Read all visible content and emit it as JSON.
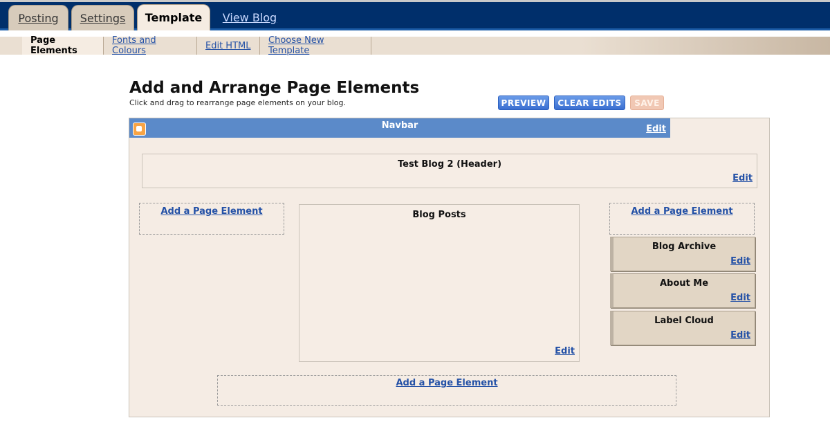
{
  "tabs": {
    "posting": "Posting",
    "settings": "Settings",
    "template": "Template",
    "view_blog": "View Blog"
  },
  "subnav": {
    "page_elements": "Page Elements",
    "fonts_colours": "Fonts and Colours",
    "edit_html": "Edit HTML",
    "choose_template": "Choose New Template"
  },
  "heading": {
    "title": "Add and Arrange Page Elements",
    "subtitle": "Click and drag to rearrange page elements on your blog."
  },
  "buttons": {
    "preview": "PREVIEW",
    "clear_edits": "CLEAR EDITS",
    "save": "SAVE"
  },
  "navbar": {
    "label": "Navbar",
    "edit": "Edit"
  },
  "header": {
    "title": "Test Blog 2 (Header)",
    "edit": "Edit"
  },
  "left_column": {
    "add": "Add a Page Element"
  },
  "main": {
    "title": "Blog Posts",
    "edit": "Edit"
  },
  "right_column": {
    "add": "Add a Page Element",
    "widgets": [
      {
        "title": "Blog Archive",
        "edit": "Edit"
      },
      {
        "title": "About Me",
        "edit": "Edit"
      },
      {
        "title": "Label Cloud",
        "edit": "Edit"
      }
    ]
  },
  "footer": {
    "add": "Add a Page Element"
  },
  "colors": {
    "tabbar_bg": "#002f6b",
    "link": "#2451a6",
    "navbar_bg": "#5b8ac9",
    "canvas_bg": "#f5ece4"
  }
}
